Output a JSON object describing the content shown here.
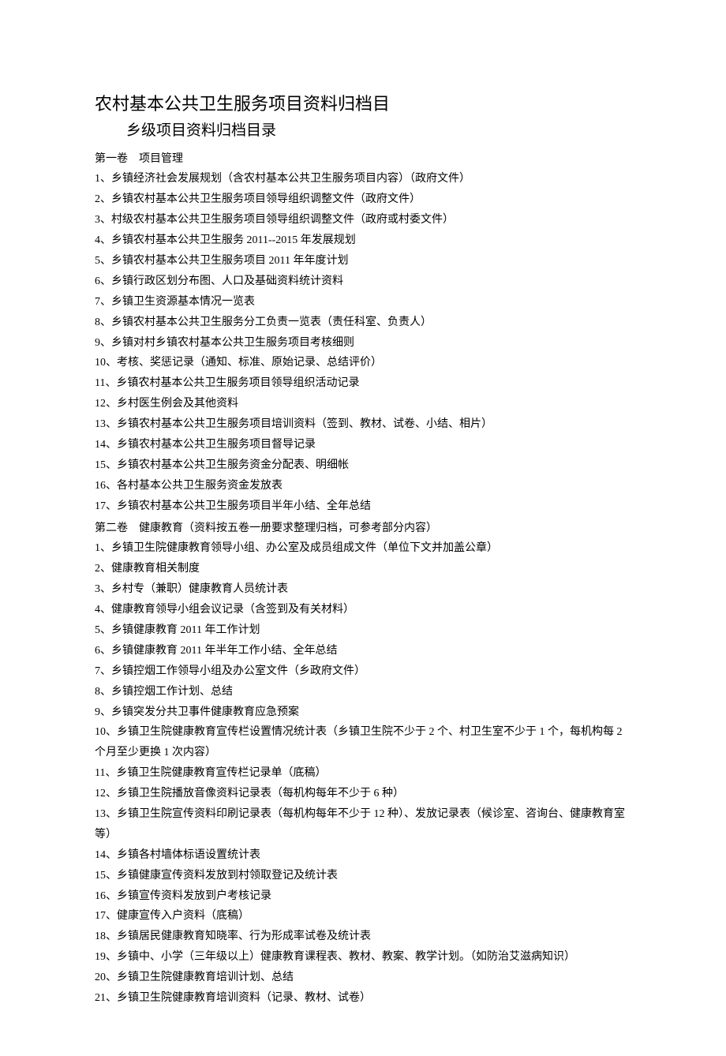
{
  "title": "农村基本公共卫生服务项目资料归档目",
  "subtitle": "乡级项目资料归档目录",
  "sections": [
    {
      "header": "第一卷　项目管理",
      "items": [
        "1、乡镇经济社会发展规划（含农村基本公共卫生服务项目内容）（政府文件）",
        "2、乡镇农村基本公共卫生服务项目领导组织调整文件（政府文件）",
        "3、村级农村基本公共卫生服务项目领导组织调整文件（政府或村委文件）",
        "4、乡镇农村基本公共卫生服务 2011--2015 年发展规划",
        "5、乡镇农村基本公共卫生服务项目 2011 年年度计划",
        "6、乡镇行政区划分布图、人口及基础资料统计资料",
        "7、乡镇卫生资源基本情况一览表",
        "8、乡镇农村基本公共卫生服务分工负责一览表（责任科室、负责人）",
        "9、乡镇对村乡镇农村基本公共卫生服务项目考核细则",
        "10、考核、奖惩记录（通知、标准、原始记录、总结评价）",
        "11、乡镇农村基本公共卫生服务项目领导组织活动记录",
        "12、乡村医生例会及其他资料",
        "13、乡镇农村基本公共卫生服务项目培训资料（签到、教材、试卷、小结、相片）",
        "14、乡镇农村基本公共卫生服务项目督导记录",
        "15、乡镇农村基本公共卫生服务资金分配表、明细帐",
        "16、各村基本公共卫生服务资金发放表",
        "17、乡镇农村基本公共卫生服务项目半年小结、全年总结"
      ]
    },
    {
      "header": "第二卷　健康教育（资料按五卷一册要求整理归档，可参考部分内容）",
      "items": [
        "1、乡镇卫生院健康教育领导小组、办公室及成员组成文件（单位下文并加盖公章）",
        "2、健康教育相关制度",
        "3、乡村专（兼职）健康教育人员统计表",
        "4、健康教育领导小组会议记录（含签到及有关材料）",
        "5、乡镇健康教育 2011 年工作计划",
        "6、乡镇健康教育 2011 年半年工作小结、全年总结",
        "7、乡镇控烟工作领导小组及办公室文件（乡政府文件）",
        "8、乡镇控烟工作计划、总结",
        "9、乡镇突发分共卫事件健康教育应急预案",
        "10、乡镇卫生院健康教育宣传栏设置情况统计表（乡镇卫生院不少于 2 个、村卫生室不少于 1 个，每机构每 2 个月至少更换 1 次内容）",
        "11、乡镇卫生院健康教育宣传栏记录单（底稿）",
        "12、乡镇卫生院播放音像资料记录表（每机构每年不少于 6 种）",
        "13、乡镇卫生院宣传资料印刷记录表（每机构每年不少于 12 种）、发放记录表（候诊室、咨询台、健康教育室等）",
        "14、乡镇各村墙体标语设置统计表",
        "15、乡镇健康宣传资料发放到村领取登记及统计表",
        "16、乡镇宣传资料发放到户考核记录",
        "17、健康宣传入户资料（底稿）",
        "18、乡镇居民健康教育知晓率、行为形成率试卷及统计表",
        "19、乡镇中、小学（三年级以上）健康教育课程表、教材、教案、教学计划。（如防治艾滋病知识）",
        "20、乡镇卫生院健康教育培训计划、总结",
        "21、乡镇卫生院健康教育培训资料（记录、教材、试卷）"
      ]
    }
  ]
}
